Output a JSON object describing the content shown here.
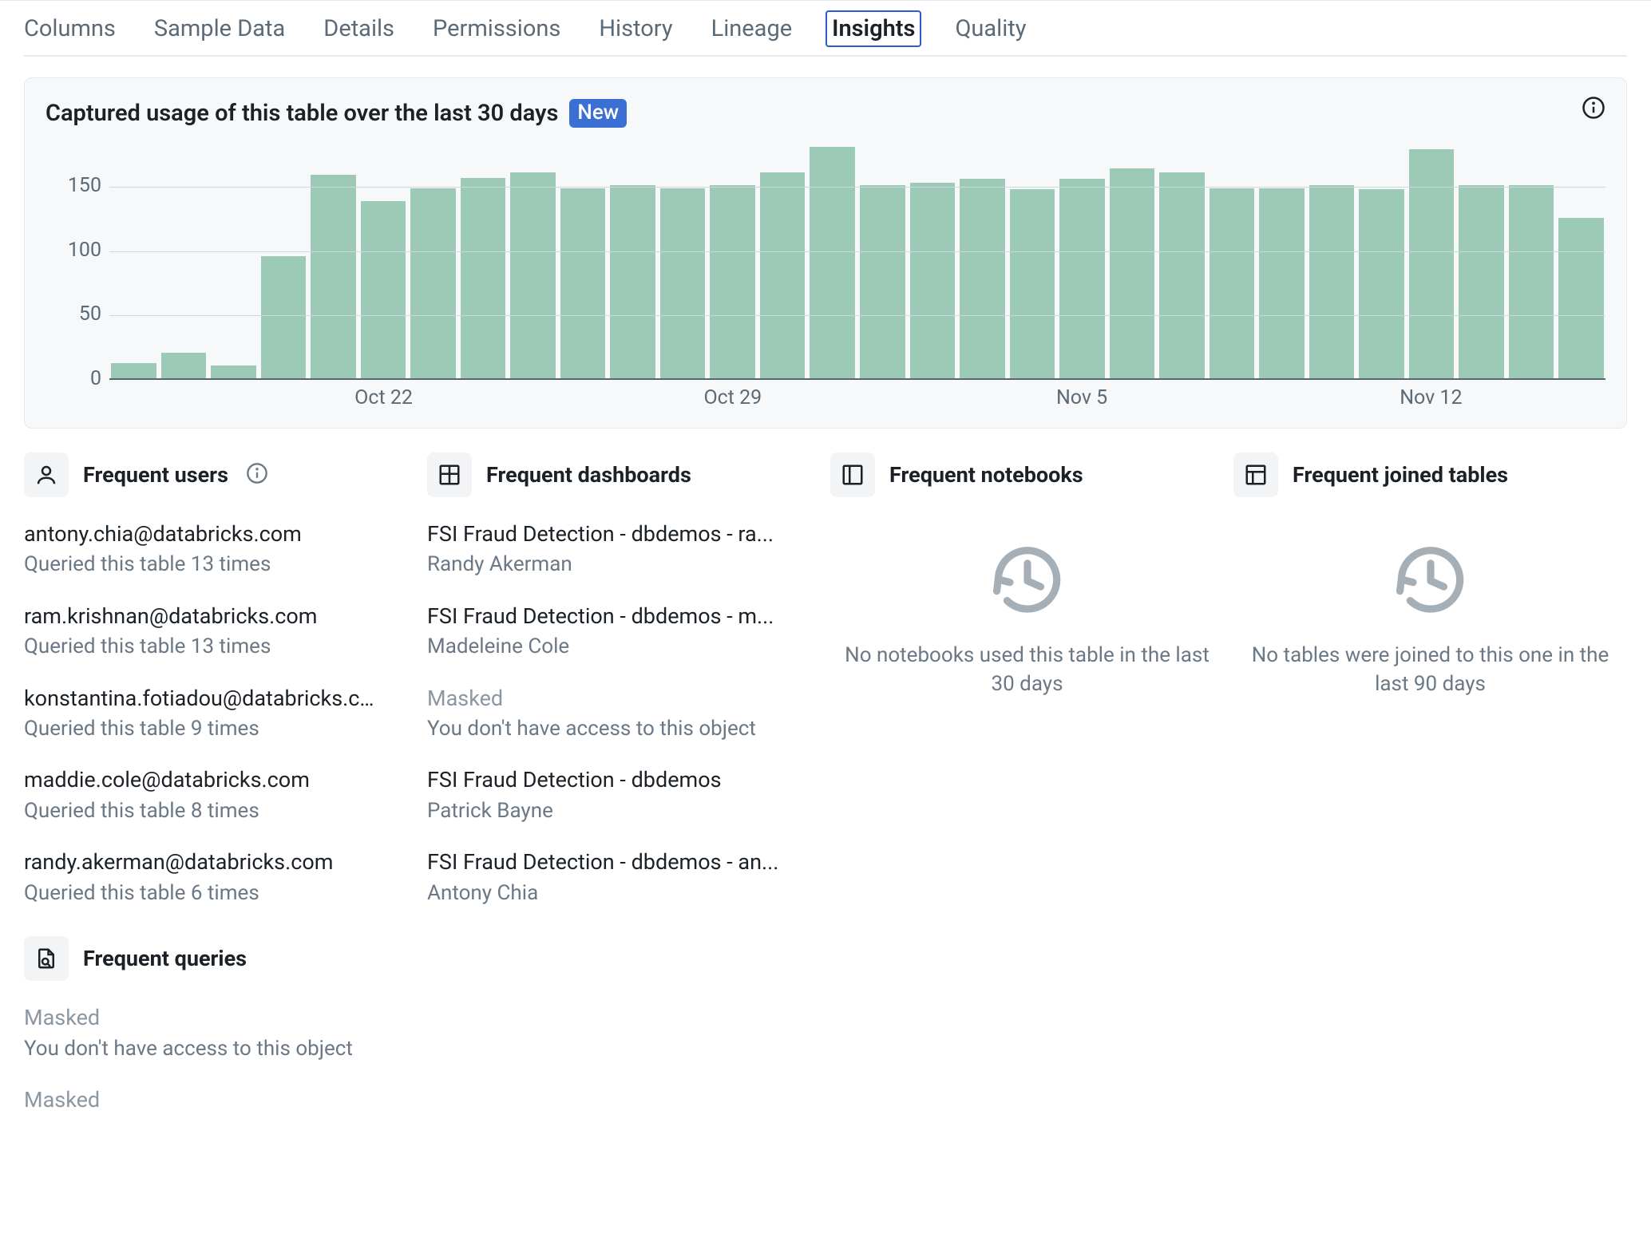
{
  "tabs": [
    "Columns",
    "Sample Data",
    "Details",
    "Permissions",
    "History",
    "Lineage",
    "Insights",
    "Quality"
  ],
  "active_tab": 6,
  "chart": {
    "title": "Captured usage of this table over the last 30 days",
    "badge": "New"
  },
  "chart_data": {
    "type": "bar",
    "title": "Captured usage of this table over the last 30 days",
    "xlabel": "",
    "ylabel": "",
    "ylim": [
      0,
      180
    ],
    "yticks": [
      0,
      50,
      100,
      150
    ],
    "xticks": [
      {
        "index": 5,
        "label": "Oct 22"
      },
      {
        "index": 12,
        "label": "Oct 29"
      },
      {
        "index": 19,
        "label": "Nov 5"
      },
      {
        "index": 26,
        "label": "Nov 12"
      }
    ],
    "values": [
      12,
      20,
      10,
      95,
      158,
      138,
      148,
      156,
      160,
      148,
      150,
      148,
      150,
      160,
      180,
      150,
      152,
      155,
      147,
      155,
      163,
      160,
      148,
      148,
      150,
      147,
      178,
      150,
      150,
      125
    ]
  },
  "sections": {
    "users": {
      "title": "Frequent users",
      "items": [
        {
          "primary": "antony.chia@databricks.com",
          "secondary": "Queried this table 13 times"
        },
        {
          "primary": "ram.krishnan@databricks.com",
          "secondary": "Queried this table 13 times"
        },
        {
          "primary": "konstantina.fotiadou@databricks.com",
          "secondary": "Queried this table 9 times"
        },
        {
          "primary": "maddie.cole@databricks.com",
          "secondary": "Queried this table 8 times"
        },
        {
          "primary": "randy.akerman@databricks.com",
          "secondary": "Queried this table 6 times"
        }
      ]
    },
    "dashboards": {
      "title": "Frequent dashboards",
      "items": [
        {
          "primary": "FSI Fraud Detection - dbdemos - ra...",
          "secondary": "Randy Akerman"
        },
        {
          "primary": "FSI Fraud Detection - dbdemos - m...",
          "secondary": "Madeleine Cole"
        },
        {
          "primary": "Masked",
          "secondary": "You don't have access to this object",
          "masked": true
        },
        {
          "primary": "FSI Fraud Detection - dbdemos",
          "secondary": "Patrick Bayne"
        },
        {
          "primary": "FSI Fraud Detection - dbdemos - an...",
          "secondary": "Antony Chia"
        }
      ]
    },
    "notebooks": {
      "title": "Frequent notebooks",
      "empty": "No notebooks used this table in the last 30 days"
    },
    "joined": {
      "title": "Frequent joined tables",
      "empty": "No tables were joined to this one in the last 90 days"
    },
    "queries": {
      "title": "Frequent queries",
      "items": [
        {
          "primary": "Masked",
          "secondary": "You don't have access to this object",
          "masked": true
        },
        {
          "primary": "Masked",
          "secondary": "",
          "masked": true
        }
      ]
    }
  }
}
